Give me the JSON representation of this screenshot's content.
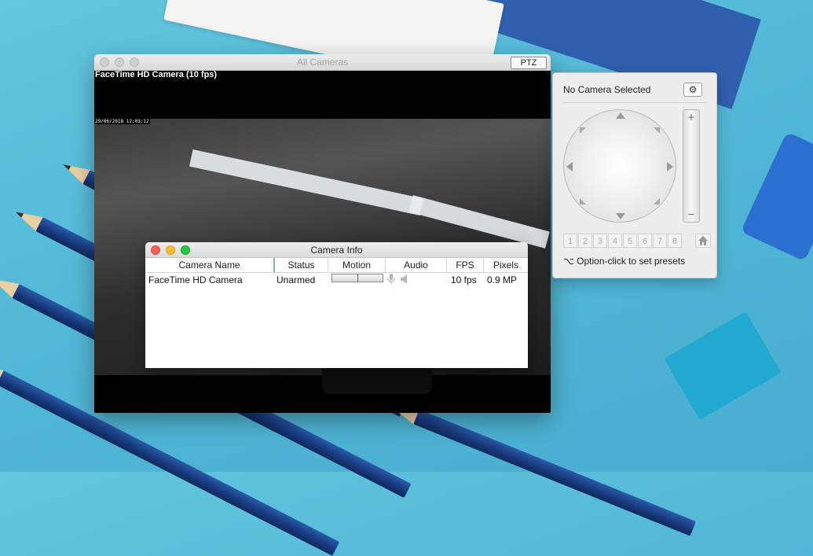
{
  "main_window": {
    "title": "All Cameras",
    "ptz_button": "PTZ",
    "camera_label": "FaceTime HD Camera (10 fps)",
    "timestamp": "29/06/2018 12:03:12"
  },
  "camera_info": {
    "title": "Camera Info",
    "columns": [
      "Camera Name",
      "Status",
      "Motion",
      "Audio",
      "FPS",
      "Pixels"
    ],
    "rows": [
      {
        "camera_name": "FaceTime HD Camera",
        "status": "Unarmed",
        "motion_level": 0.5,
        "fps": "10 fps",
        "pixels": "0.9 MP"
      }
    ]
  },
  "ptz_panel": {
    "heading": "No Camera Selected",
    "settings_icon": "gear-icon",
    "zoom_in": "+",
    "zoom_out": "−",
    "presets": [
      "1",
      "2",
      "3",
      "4",
      "5",
      "6",
      "7",
      "8"
    ],
    "hint": "⌥ Option-click to set presets"
  }
}
